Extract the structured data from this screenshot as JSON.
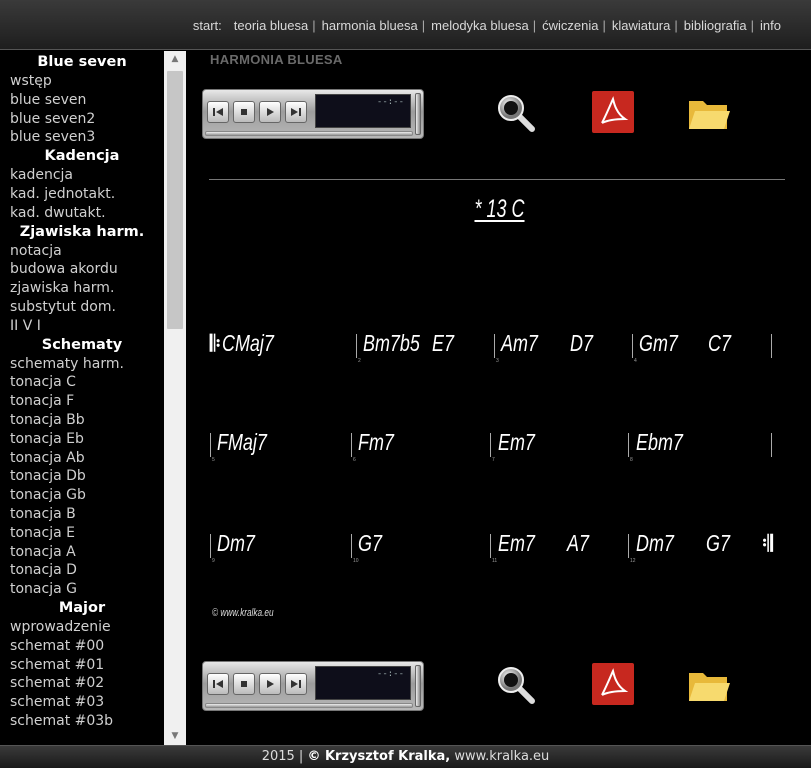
{
  "nav": {
    "start_label": "start:",
    "items": [
      "teoria bluesa",
      "harmonia bluesa",
      "melodyka bluesa",
      "ćwiczenia",
      "klawiatura",
      "bibliografia",
      "info"
    ],
    "separator": "|"
  },
  "sidebar": {
    "groups": [
      {
        "heading": "Blue seven",
        "links": [
          "wstęp",
          "blue seven",
          "blue seven2",
          "blue seven3"
        ]
      },
      {
        "heading": "Kadencja",
        "links": [
          "kadencja",
          "kad. jednotakt.",
          "kad. dwutakt."
        ]
      },
      {
        "heading": "Zjawiska harm.",
        "links": [
          "notacja",
          "budowa akordu",
          "zjawiska harm.",
          "substytut dom.",
          "II V I"
        ]
      },
      {
        "heading": "Schematy",
        "links": [
          "schematy harm.",
          "tonacja C",
          "tonacja F",
          "tonacja Bb",
          "tonacja Eb",
          "tonacja Ab",
          "tonacja Db",
          "tonacja Gb",
          "tonacja B",
          "tonacja E",
          "tonacja A",
          "tonacja D",
          "tonacja G"
        ]
      },
      {
        "heading": "Major",
        "links": [
          "wprowadzenie",
          "schemat #00",
          "schemat #01",
          "schemat #02",
          "schemat #03",
          "schemat #03b"
        ]
      }
    ]
  },
  "main": {
    "section_title": "HARMONIA BLUESA",
    "player_time": "--:--",
    "score_title": "* 13 C",
    "rows": [
      {
        "chords": [
          "CMaj7",
          "Bm7b5",
          "E7",
          "Am7",
          "D7",
          "Gm7",
          "C7"
        ],
        "bar_numbers": [
          "1",
          "2",
          "3",
          "4"
        ]
      },
      {
        "chords": [
          "FMaj7",
          "Fm7",
          "Em7",
          "Ebm7"
        ],
        "bar_numbers": [
          "5",
          "6",
          "7",
          "8"
        ]
      },
      {
        "chords": [
          "Dm7",
          "G7",
          "Em7",
          "A7",
          "Dm7",
          "G7"
        ],
        "bar_numbers": [
          "9",
          "10",
          "11",
          "12"
        ]
      }
    ],
    "copyright": "© www.kralka.eu"
  },
  "footer": {
    "year": "2015 |",
    "owner": "© Krzysztof Kralka,",
    "site": "www.kralka.eu"
  },
  "colors": {
    "background": "#000000",
    "text": "#d0d0d0",
    "heading": "#ffffff",
    "pdf_red": "#cc2222",
    "folder_yellow": "#f5d45c"
  }
}
